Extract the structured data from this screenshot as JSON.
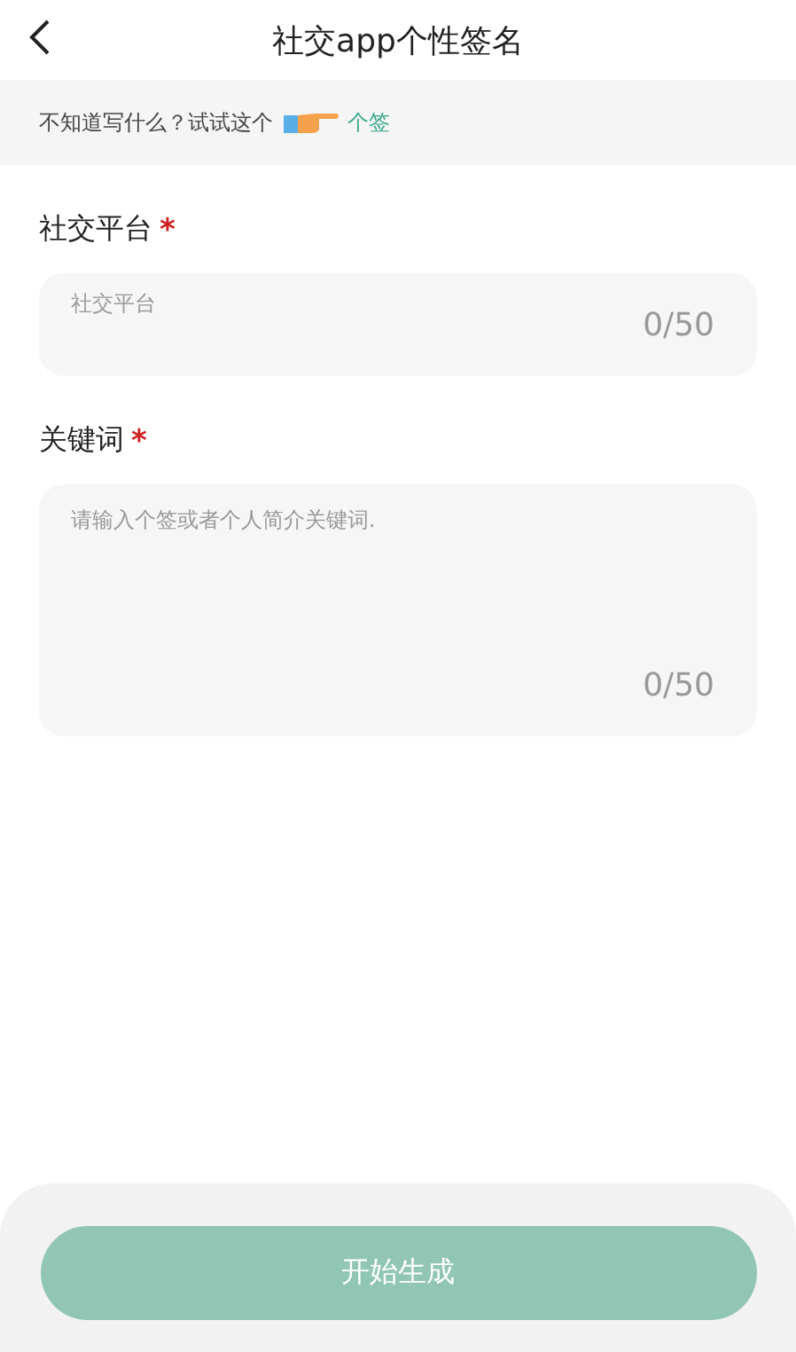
{
  "header": {
    "title": "社交app个性签名"
  },
  "tip": {
    "text": "不知道写什么？试试这个",
    "link": "个签"
  },
  "fields": [
    {
      "label": "社交平台",
      "required_mark": "*",
      "kind": "input",
      "placeholder": "社交平台",
      "count": "0/50"
    },
    {
      "label": "关键词",
      "required_mark": "*",
      "kind": "textarea",
      "placeholder": "请输入个签或者个人简介关键词.",
      "count": "0/50"
    }
  ],
  "submit": {
    "label": "开始生成",
    "disabled": true
  }
}
